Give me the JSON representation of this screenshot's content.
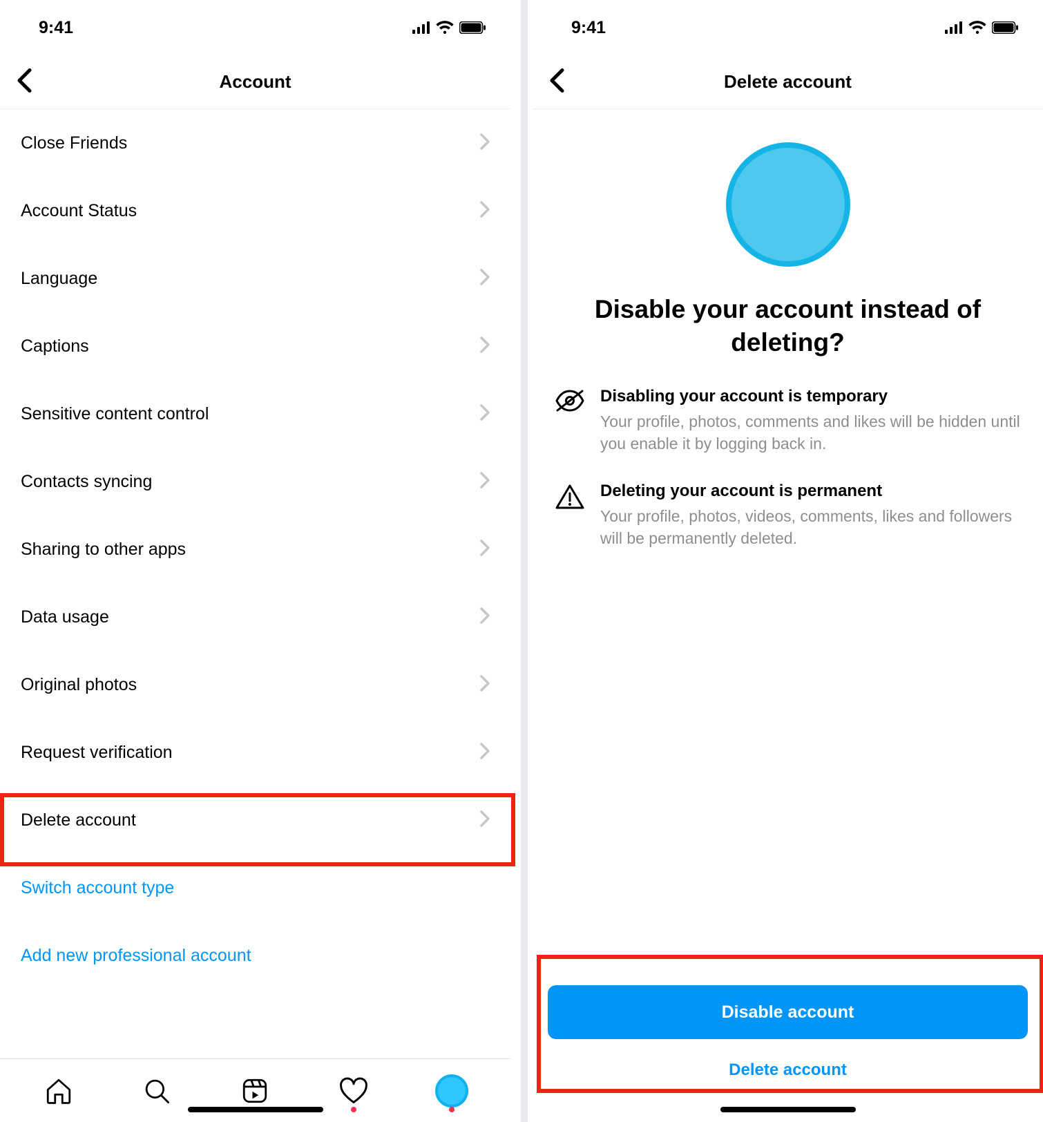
{
  "status": {
    "time": "9:41"
  },
  "screenA": {
    "title": "Account",
    "rows": [
      "Close Friends",
      "Account Status",
      "Language",
      "Captions",
      "Sensitive content control",
      "Contacts syncing",
      "Sharing to other apps",
      "Data usage",
      "Original photos",
      "Request verification",
      "Delete account"
    ],
    "links": [
      "Switch account type",
      "Add new professional account"
    ]
  },
  "screenB": {
    "title": "Delete account",
    "heading": "Disable your account instead of deleting?",
    "block1_title": "Disabling your account is temporary",
    "block1_body": "Your profile, photos, comments and likes will be hidden until you enable it by logging back in.",
    "block2_title": "Deleting your account is permanent",
    "block2_body": "Your profile, photos, videos, comments, likes and followers will be permanently deleted.",
    "primary_btn": "Disable account",
    "secondary_btn": "Delete account"
  }
}
